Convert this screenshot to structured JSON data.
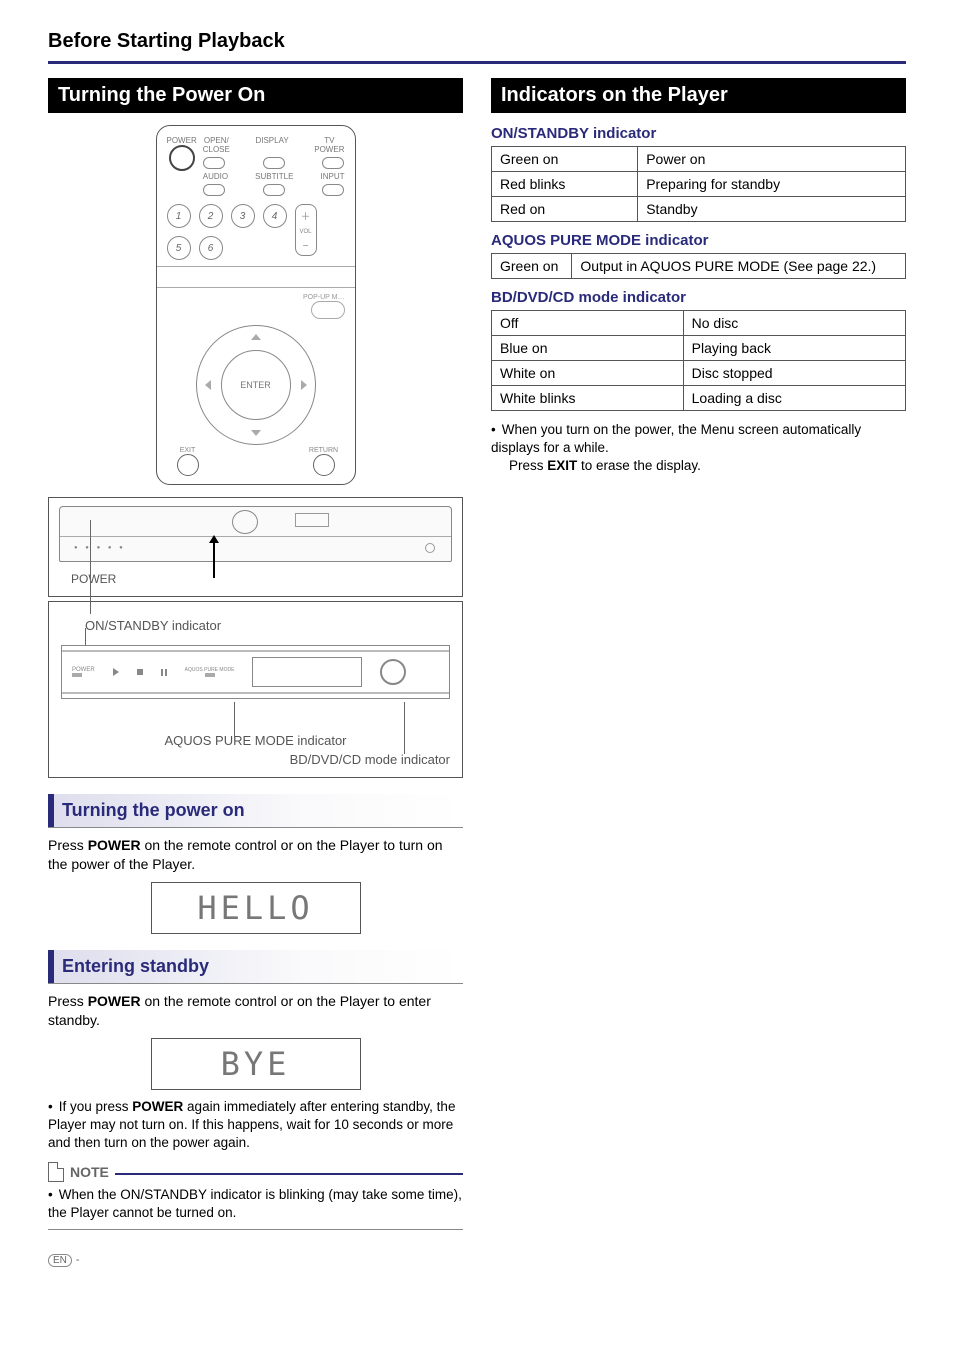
{
  "page": {
    "title": "Before Starting Playback"
  },
  "left": {
    "header": "Turning the Power On",
    "remote": {
      "labels": {
        "power": "POWER",
        "open_close": "OPEN/\nCLOSE",
        "display": "DISPLAY",
        "tv_power": "TV\nPOWER",
        "audio": "AUDIO",
        "subtitle": "SUBTITLE",
        "input": "INPUT",
        "vol": "VOL",
        "popup": "POP-UP M…",
        "enter": "ENTER",
        "exit": "EXIT",
        "return": "RETURN",
        "nums": [
          "1",
          "2",
          "3",
          "4",
          "5",
          "6"
        ]
      }
    },
    "player_box": {
      "power_label": "POWER",
      "on_standby_label": "ON/STANDBY indicator",
      "aquos_label": "AQUOS PURE MODE indicator",
      "mode_label": "BD/DVD/CD mode indicator",
      "strip_tiny": {
        "power": "POWER",
        "apm": "AQUOS PURE MODE"
      }
    },
    "turning_on": {
      "header": "Turning the power on",
      "text_before": "Press ",
      "text_bold": "POWER",
      "text_after": " on the remote control or on the Player to turn on the power of the Player.",
      "display": "HELLO"
    },
    "standby": {
      "header": "Entering standby",
      "text_before": "Press ",
      "text_bold": "POWER",
      "text_after": " on the remote control or on the Player to enter standby.",
      "display": "BYE",
      "bullet_before": "If you press ",
      "bullet_bold": "POWER",
      "bullet_after": " again immediately after entering standby, the Player may not turn on. If this happens, wait for 10 seconds or more and then turn on the power again."
    },
    "note": {
      "label": "NOTE",
      "text": "When the ON/STANDBY indicator is blinking (may take some time), the Player cannot be turned on."
    }
  },
  "right": {
    "header": "Indicators on the Player",
    "tables": {
      "onstandby": {
        "title": "ON/STANDBY indicator",
        "rows": [
          [
            "Green on",
            "Power on"
          ],
          [
            "Red blinks",
            "Preparing for standby"
          ],
          [
            "Red on",
            "Standby"
          ]
        ]
      },
      "aquos": {
        "title": "AQUOS PURE MODE indicator",
        "rows": [
          [
            "Green on",
            "Output in AQUOS PURE MODE (See page 22.)"
          ]
        ]
      },
      "mode": {
        "title": "BD/DVD/CD mode indicator",
        "rows": [
          [
            "Off",
            "No disc"
          ],
          [
            "Blue on",
            "Playing back"
          ],
          [
            "White on",
            "Disc stopped"
          ],
          [
            "White blinks",
            "Loading a disc"
          ]
        ]
      }
    },
    "bullet": {
      "line1": "When you turn on the power, the Menu screen automatically displays for a while.",
      "line2_before": "Press ",
      "line2_bold": "EXIT",
      "line2_after": " to erase the display."
    }
  },
  "footer": {
    "en": "EN",
    "dash": " -"
  }
}
